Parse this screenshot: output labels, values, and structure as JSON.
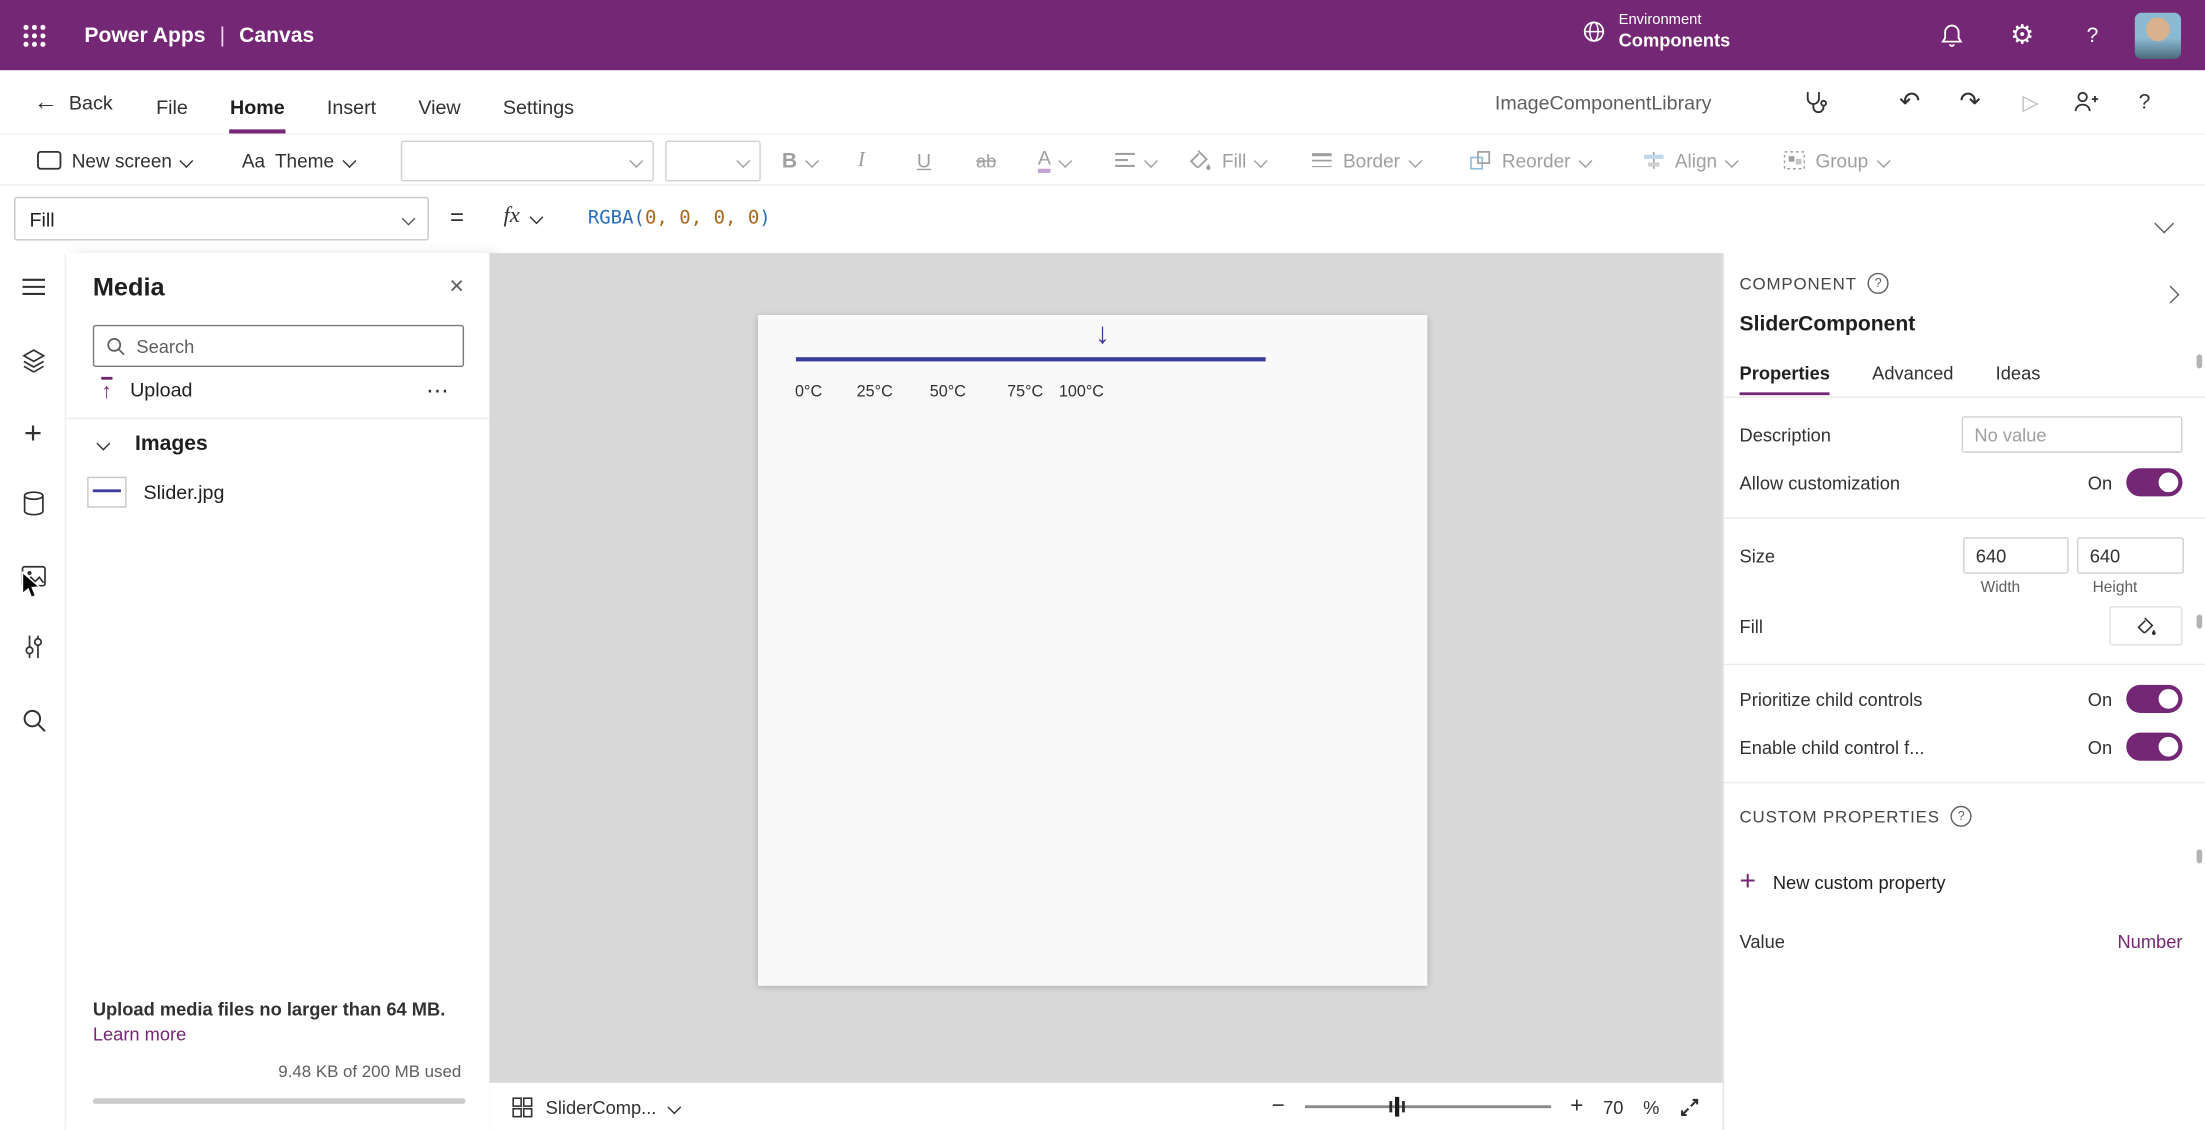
{
  "colors": {
    "brand": "#742774",
    "slider_line": "#3b3b9d",
    "formula_function": "#2b6cb8",
    "formula_number": "#a86a1e",
    "canvas_background": "#d8d8d8"
  },
  "icons": {
    "gear": "⚙",
    "help": "?",
    "back": "←",
    "undo": "↶",
    "redo": "↷",
    "play": "▷",
    "close": "×",
    "more": "⋯",
    "upload_arrow": "↑",
    "slider_arrow": "↓",
    "zoom_out": "−",
    "zoom_in": "+",
    "plus": "+",
    "theme": "Aa",
    "bold": "B",
    "italic": "I",
    "underline": "U",
    "strikethrough": "ab",
    "font_color": "A"
  },
  "topbar": {
    "product": "Power Apps",
    "divider": "|",
    "area": "Canvas",
    "environment_label": "Environment",
    "environment_name": "Components"
  },
  "menubar": {
    "back": "Back",
    "items": [
      "File",
      "Home",
      "Insert",
      "View",
      "Settings"
    ],
    "active": "Home",
    "library": "ImageComponentLibrary"
  },
  "toolbar": {
    "new_screen": "New screen",
    "theme": "Theme",
    "fill": "Fill",
    "border": "Border",
    "reorder": "Reorder",
    "align": "Align",
    "group": "Group"
  },
  "formula": {
    "property": "Fill",
    "equals": "=",
    "fx": "fx",
    "function": "RGBA",
    "open": "(",
    "args": "0, 0, 0, 0",
    "close": ")"
  },
  "media": {
    "title": "Media",
    "search_placeholder": "Search",
    "upload": "Upload",
    "section": "Images",
    "files": [
      "Slider.jpg"
    ],
    "note": "Upload media files no larger than 64 MB.",
    "learn_more": "Learn more",
    "usage": "9.48 KB of 200 MB used"
  },
  "canvas": {
    "ticks": [
      "0°C",
      "25°C",
      "50°C",
      "75°C",
      "100°C"
    ],
    "screen_name": "SliderComp...",
    "zoom_value": "70",
    "zoom_unit": "%"
  },
  "panel": {
    "header": "COMPONENT",
    "name": "SliderComponent",
    "tabs": [
      "Properties",
      "Advanced",
      "Ideas"
    ],
    "active_tab": "Properties",
    "description_label": "Description",
    "description_placeholder": "No value",
    "allow_customization": "Allow customization",
    "on": "On",
    "size_label": "Size",
    "width_value": "640",
    "height_value": "640",
    "width_label": "Width",
    "height_label": "Height",
    "fill_label": "Fill",
    "prioritize_label": "Prioritize child controls",
    "enable_child_label": "Enable child control f...",
    "custom_props": "CUSTOM PROPERTIES",
    "new_custom_prop": "New custom property",
    "value_label": "Value",
    "value_type": "Number"
  }
}
